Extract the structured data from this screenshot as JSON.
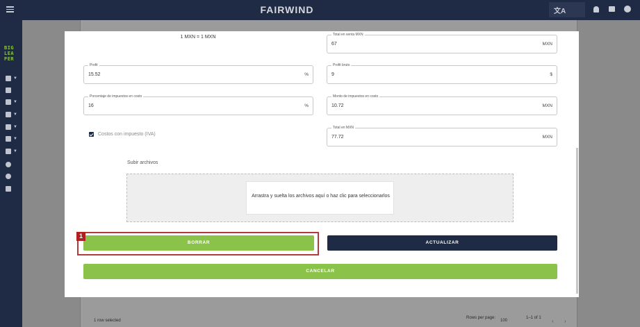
{
  "header": {
    "brand": "FAIRWIND"
  },
  "sidebar": {
    "logo_lines": [
      "BIG",
      "LEA",
      "PER"
    ]
  },
  "background": {
    "rows_selected": "1 row selected",
    "rows_per_page_label": "Rows per page:",
    "rows_per_page_value": "100",
    "pagination": "1–1 of 1"
  },
  "modal": {
    "rate": "1 MXN = 1 MXN",
    "fields": {
      "total_sale": {
        "label": "Total en venta MXN",
        "value": "67",
        "suffix": "MXN"
      },
      "profit": {
        "label": "Profit",
        "value": "15.52",
        "suffix": "%"
      },
      "gross_profit": {
        "label": "Profit bruto",
        "value": "9",
        "suffix": "$"
      },
      "tax_percent": {
        "label": "Porcentaje de impuestos en costo",
        "value": "16",
        "suffix": "%"
      },
      "tax_amount": {
        "label": "Monto de impuestos en costo",
        "value": "10.72",
        "suffix": "MXN"
      },
      "total_mxn": {
        "label": "Total en MXN",
        "value": "77.72",
        "suffix": "MXN"
      }
    },
    "checkbox_label": "Costos con impuesto (IVA)",
    "upload_title": "Subir archivos",
    "dropzone_text": "Arrastra y suelta los archivos aquí o haz clic para seleccionarlos",
    "buttons": {
      "delete": "BORRAR",
      "update": "ACTUALIZAR",
      "cancel": "CANCELAR"
    }
  },
  "annotation": {
    "marker": "1"
  },
  "colors": {
    "navy": "#1f2a44",
    "green": "#8bc34a",
    "highlight": "#b33a3a"
  }
}
